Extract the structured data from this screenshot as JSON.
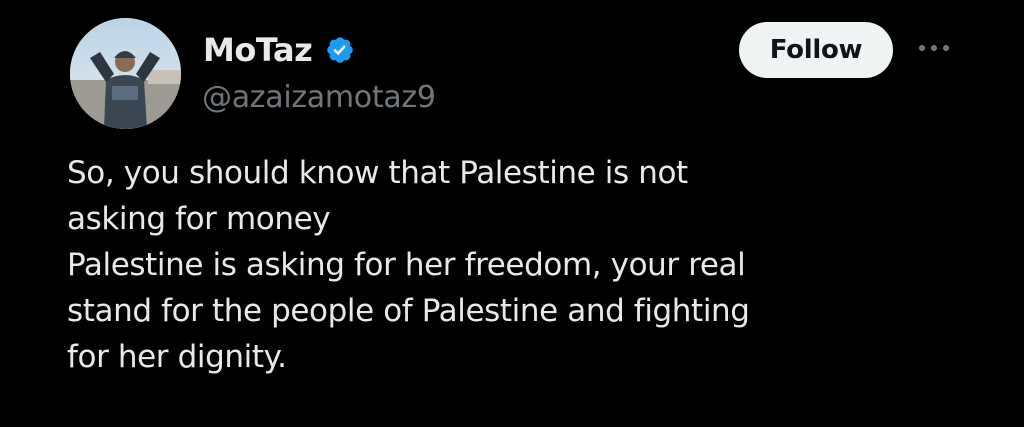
{
  "author": {
    "display_name": "MoTaz",
    "handle": "@azaizamotaz9",
    "verified": true,
    "avatar_icon": "avatar-photo",
    "verified_icon": "verified-badge-icon",
    "verified_color": "#1d9bf0"
  },
  "actions": {
    "follow_label": "Follow",
    "more_icon": "more-options-icon"
  },
  "tweet": {
    "lines": [
      "So, you should know that Palestine is not",
      "asking for money",
      "Palestine is asking for her freedom, your real",
      "stand for the people of Palestine and fighting",
      "for her dignity."
    ]
  },
  "colors": {
    "background": "#000000",
    "text_primary": "#e7e9ea",
    "text_secondary": "#71767b",
    "follow_bg": "#eff3f4",
    "follow_text": "#0f1419"
  }
}
